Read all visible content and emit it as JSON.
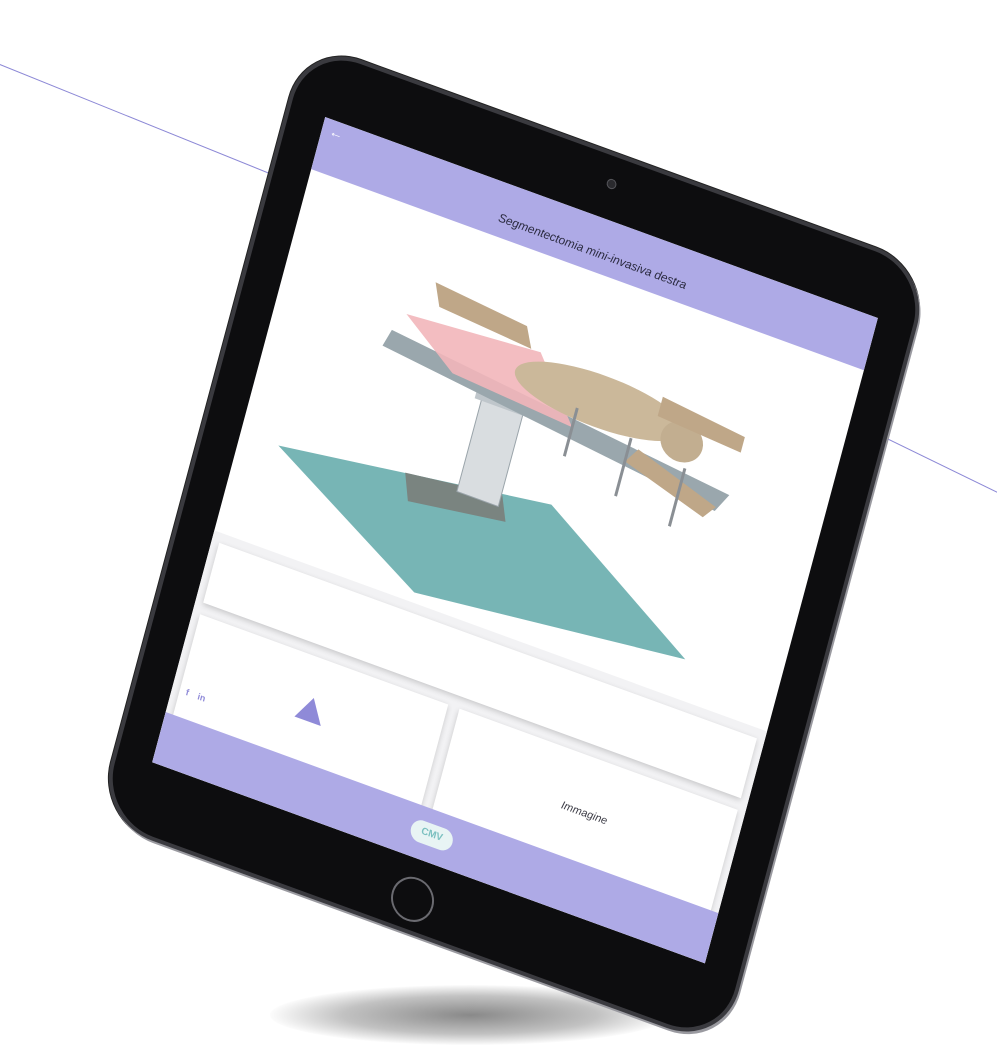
{
  "app": {
    "title": "Segmentectomia mini-invasiva destra"
  },
  "header": {
    "back_icon": "arrow-left-icon",
    "back_glyph": "←"
  },
  "content": {
    "illustration": "patient-on-operating-table",
    "warning_icon": "warning-triangle-icon",
    "image_card_label": "Immagine"
  },
  "footer": {
    "facebook_glyph": "f",
    "linkedin_glyph": "in",
    "logo_text": "CMV"
  },
  "colors": {
    "accent": "#aeaae6",
    "icon": "#8f8ad8",
    "line": "#8c88d6"
  }
}
